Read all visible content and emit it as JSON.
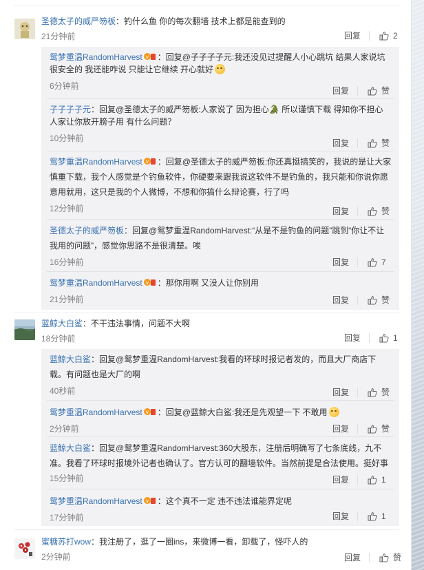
{
  "ui": {
    "reply_label": "回复",
    "like_zan": "赞",
    "reply_prefix": "回复",
    "colors": {
      "link": "#3a72b0",
      "text": "#333333",
      "time": "#808080",
      "sub_bg": "#f2f2f5"
    }
  },
  "threads": [
    {
      "author": "圣德太子的威严笏板",
      "text": "：钓什么鱼 你的每次翻墙 技术上都是能查到的",
      "time": "21分钟前",
      "likes": "2",
      "replies": [
        {
          "author": "鸳梦重温RandomHarvest",
          "reply_to": "@子子子子元",
          "text_lines": [
            "：回复@子子子子元:我还没见过提醒人小心跳坑  结果人家说坑",
            "很安全的  我还能咋说  只能让它继续  开心就好"
          ],
          "time": "6分钟前",
          "likes": "赞"
        },
        {
          "author": "子子子子元",
          "text_lines": [
            "：回复@圣德太子的威严笏板:人家说了 因为担心🐊 所以谨慎下载 得知你不担心",
            "人家让你放开膀子用 有什么问题？"
          ],
          "time": "10分钟前",
          "likes": "赞"
        },
        {
          "author": "鸳梦重温RandomHarvest",
          "text_lines": [
            "：回复@圣德太子的威严笏板:你还真挺搞笑的，我说的是让大家",
            "慎重下载，我个人感觉是个钓鱼软件，你硬要来跟我说这软件不是钓鱼的，我只能和你说你愿",
            "意用就用，这只是我的个人微博，不想和你搞什么辩论赛，行了吗"
          ],
          "time": "12分钟前",
          "likes": "赞"
        },
        {
          "author": "圣德太子的威严笏板",
          "text_lines": [
            "：回复@鸳梦重温RandomHarvest:“从是不是钓鱼的问题”跳到“你让不让",
            "我用的问题”，感觉你思路不是很清楚。唉"
          ],
          "time": "16分钟前",
          "likes": "7"
        },
        {
          "author": "鸳梦重温RandomHarvest",
          "text_lines": [
            "：那你用啊  又没人让你别用"
          ],
          "time": "21分钟前",
          "likes": "赞"
        }
      ]
    },
    {
      "author": "蓝鲸大白鲨",
      "text": "：不干违法事情，问题不大啊",
      "time": "18分钟前",
      "likes": "1",
      "replies": [
        {
          "author": "蓝鲸大白鲨",
          "text_lines": [
            "：回复@鸳梦重温RandomHarvest:我看的环球时报记者发的，而且大厂商店下",
            "载。有问题也是大厂的啊"
          ],
          "time": "40秒前",
          "likes": "赞"
        },
        {
          "author": "鸳梦重温RandomHarvest",
          "text_lines": [
            "：回复@蓝鲸大白鲨:我还是先观望一下  不敢用"
          ],
          "time": "2分钟前",
          "likes": "赞"
        },
        {
          "author": "蓝鲸大白鲨",
          "text_lines": [
            "：回复@鸳梦重温RandomHarvest:360大股东，注册后明确写了七条底线，九不",
            "准。我看了环球时报境外记者也确认了。官方认可的翻墙软件。当然前提是合法使用。挺好事"
          ],
          "time": "15分钟前",
          "likes": "1"
        },
        {
          "author": "鸳梦重温RandomHarvest",
          "text_lines": [
            "：这个真不一定  违不违法谁能界定呢"
          ],
          "time": "17分钟前",
          "likes": "1"
        }
      ]
    },
    {
      "author": "蜜糖苏打wow",
      "text": "：我注册了，逛了一圈ins，来微博一看，卸载了，怪吓人的",
      "time": "2分钟前",
      "likes": "赞"
    }
  ]
}
